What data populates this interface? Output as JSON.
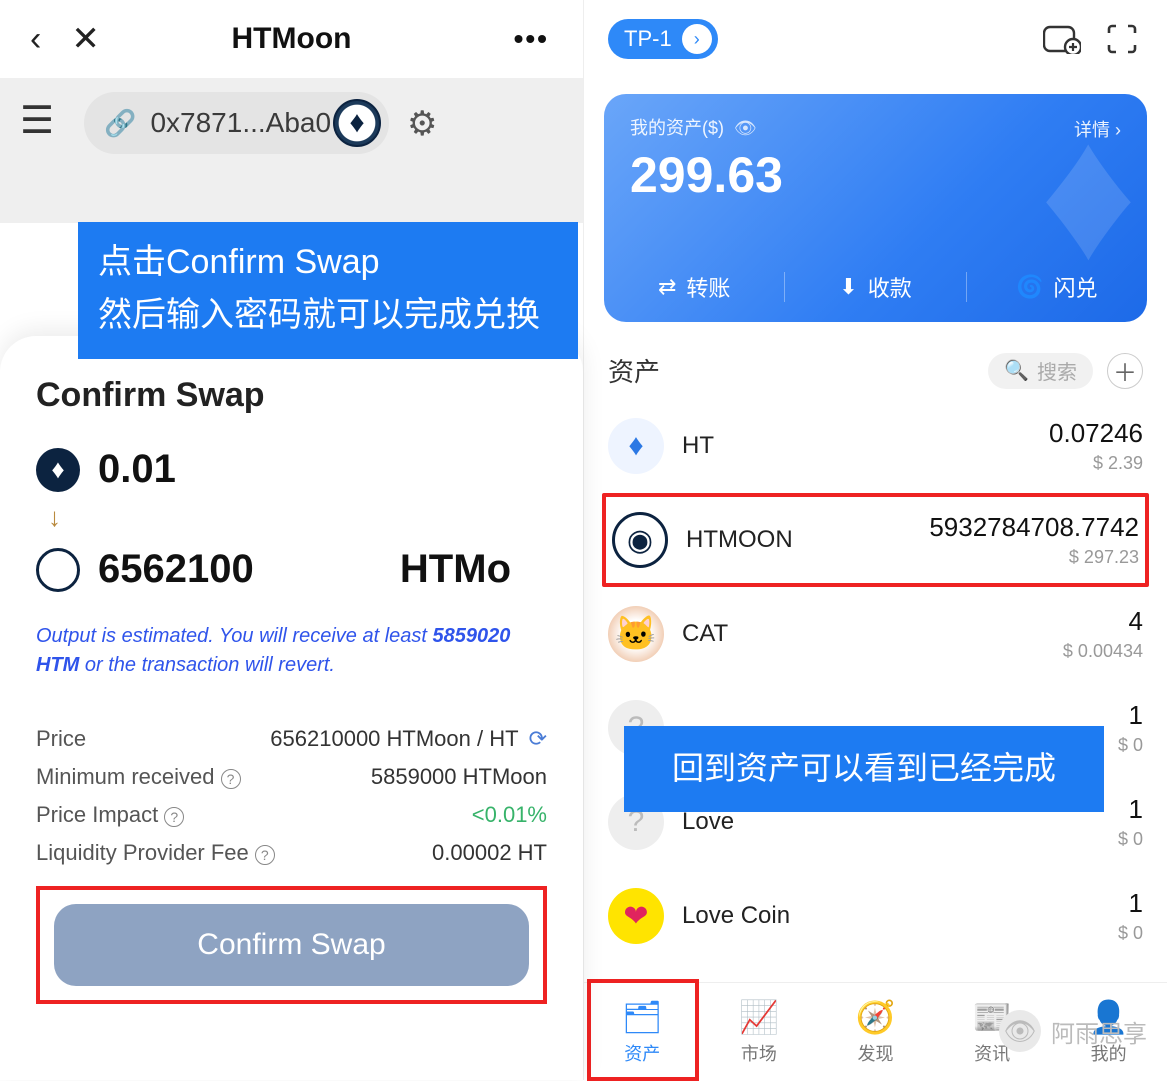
{
  "left": {
    "topbar": {
      "title": "HTMoon"
    },
    "address": "0x7871...Aba0",
    "annotation": {
      "line1": "点击Confirm Swap",
      "line2": "然后输入密码就可以完成兑换"
    },
    "sheet_title": "Confirm Swap",
    "from_amount": "0.01",
    "to_amount": "6562100",
    "to_token_label": "HTMo",
    "estimate_note_prefix": "Output is estimated. You will receive at least ",
    "estimate_note_value": "5859020 HTM",
    "estimate_note_suffix": "or the transaction will revert.",
    "details": {
      "price_label": "Price",
      "price_value": "656210000 HTMoon / HT",
      "min_label": "Minimum received",
      "min_value": "5859000 HTMoon",
      "impact_label": "Price Impact",
      "impact_value": "<0.01%",
      "fee_label": "Liquidity Provider Fee",
      "fee_value": "0.00002 HT"
    },
    "confirm_button": "Confirm Swap"
  },
  "right": {
    "wallet_tag": "TP-1",
    "balance": {
      "label": "我的资产($)",
      "detail": "详情 ›",
      "amount": "299.63",
      "actions": {
        "transfer": "转账",
        "receive": "收款",
        "swap": "闪兑"
      }
    },
    "assets_title": "资产",
    "search_placeholder": "搜索",
    "assets": [
      {
        "name": "HT",
        "value": "0.07246",
        "usd": "$ 2.39"
      },
      {
        "name": "HTMOON",
        "value": "5932784708.7742",
        "usd": "$ 297.23"
      },
      {
        "name": "CAT",
        "value": "4",
        "usd": "$ 0.00434"
      },
      {
        "name": "",
        "value": "1",
        "usd": "$ 0"
      },
      {
        "name": "Love",
        "value": "1",
        "usd": "$ 0"
      },
      {
        "name": "Love Coin",
        "value": "1",
        "usd": "$ 0"
      }
    ],
    "annotation": "回到资产可以看到已经完成",
    "nav": {
      "assets": "资产",
      "market": "市场",
      "discover": "发现",
      "news": "资讯",
      "mine": "我的"
    },
    "watermark": "阿雨思享"
  }
}
